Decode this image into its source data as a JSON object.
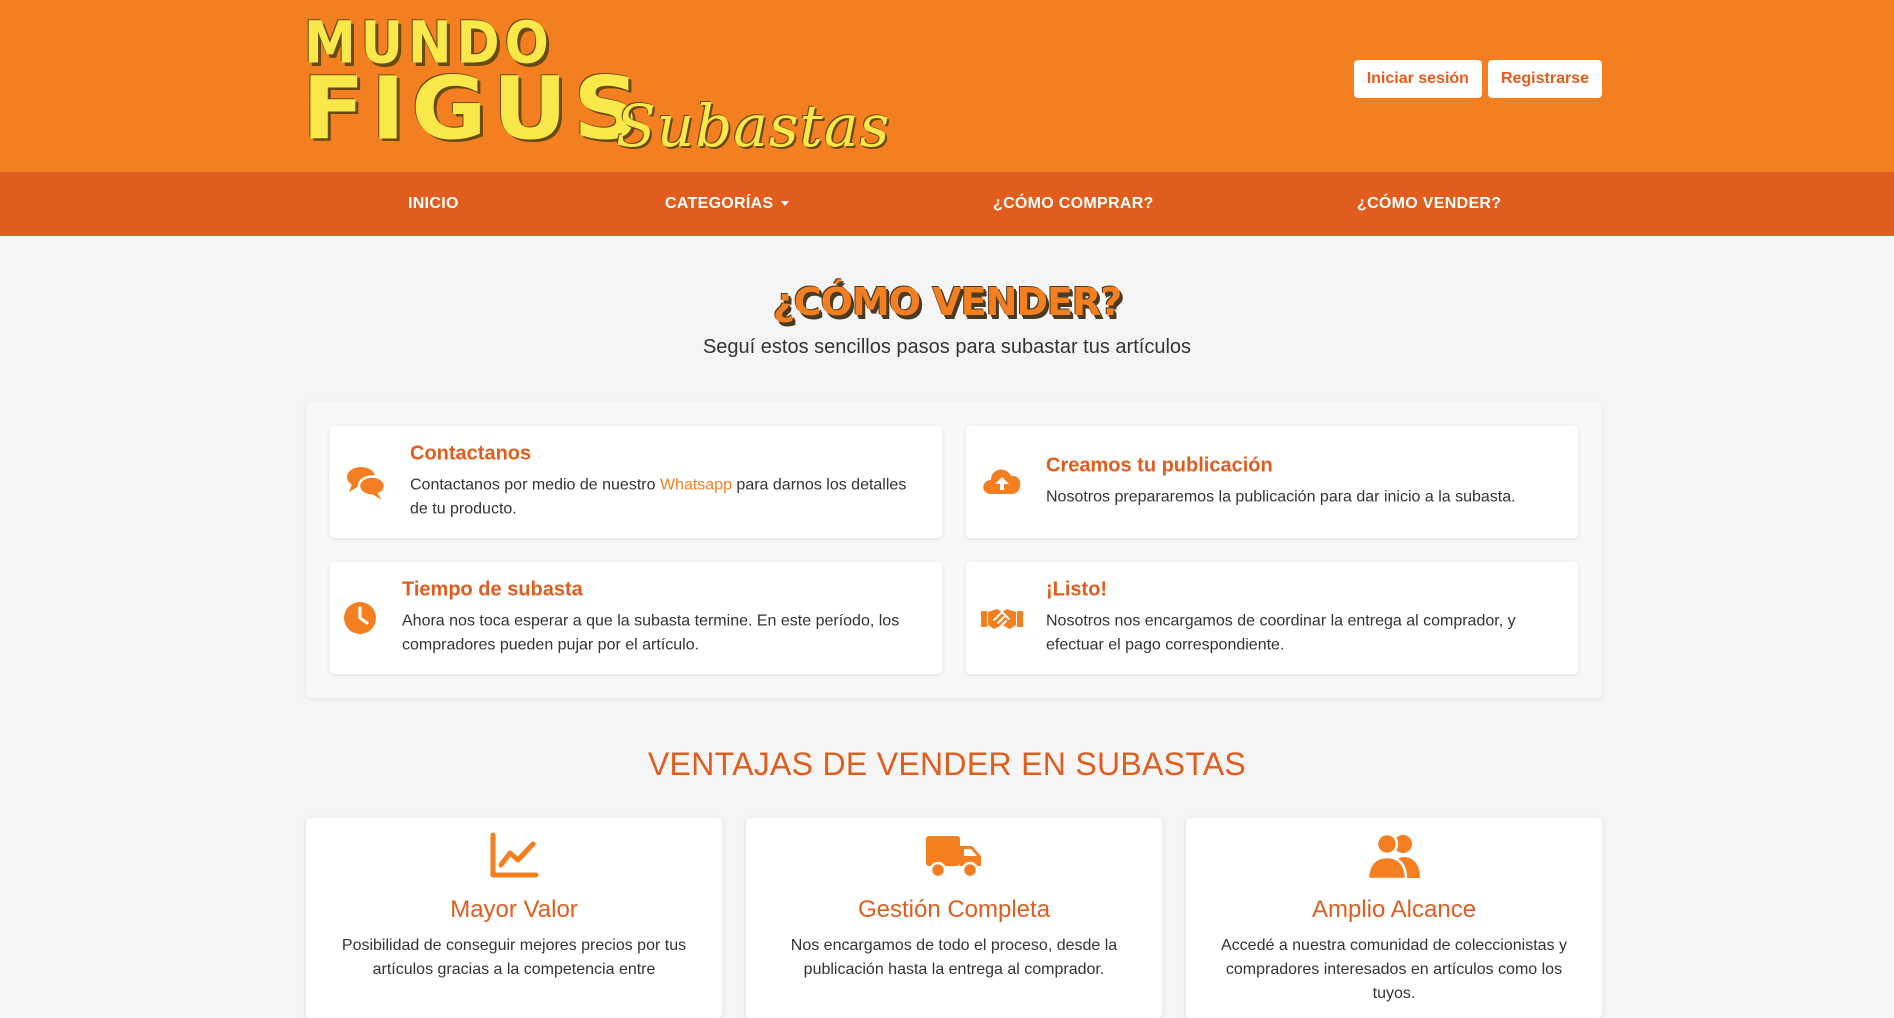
{
  "header": {
    "logo": {
      "line1": "MUNDO",
      "line2": "FIGUS",
      "tagline": "Subastas"
    },
    "login_label": "Iniciar sesión",
    "register_label": "Registrarse"
  },
  "nav": {
    "items": [
      "INICIO",
      "CATEGORÍAS",
      "¿CÓMO COMPRAR?",
      "¿CÓMO VENDER?"
    ]
  },
  "page": {
    "title": "¿CÓMO VENDER?",
    "subtitle": "Seguí estos sencillos pasos para subastar tus artículos"
  },
  "steps": [
    {
      "title": "Contactanos",
      "text_before": "Contactanos por medio de nuestro ",
      "link": "Whatsapp",
      "text_after": " para darnos los detalles de tu producto.",
      "icon": "comments-icon"
    },
    {
      "title": "Creamos tu publicación",
      "text_before": "Nosotros prepararemos la publicación para dar inicio a la subasta.",
      "icon": "cloud-upload-icon"
    },
    {
      "title": "Tiempo de subasta",
      "text_before": "Ahora nos toca esperar a que la subasta termine. En este período, los compradores pueden pujar por el artículo.",
      "icon": "clock-icon"
    },
    {
      "title": "¡Listo!",
      "text_before": "Nosotros nos encargamos de coordinar la entrega al comprador, y efectuar el pago correspondiente.",
      "icon": "handshake-icon"
    }
  ],
  "advantages": {
    "title": "VENTAJAS DE VENDER EN SUBASTAS",
    "cards": [
      {
        "title": "Mayor Valor",
        "text": "Posibilidad de conseguir mejores precios por tus artículos gracias a la competencia entre",
        "icon": "chart-line-icon"
      },
      {
        "title": "Gestión Completa",
        "text": "Nos encargamos de todo el proceso, desde la publicación hasta la entrega al comprador.",
        "icon": "truck-icon"
      },
      {
        "title": "Amplio Alcance",
        "text": "Accedé a nuestra comunidad de coleccionistas y compradores interesados en artículos como los tuyos.",
        "icon": "users-icon"
      }
    ]
  },
  "colors": {
    "primary": "#f47f20",
    "nav": "#e05d1d",
    "logo_yellow": "#f8e84a",
    "background": "#f5f5f5"
  }
}
